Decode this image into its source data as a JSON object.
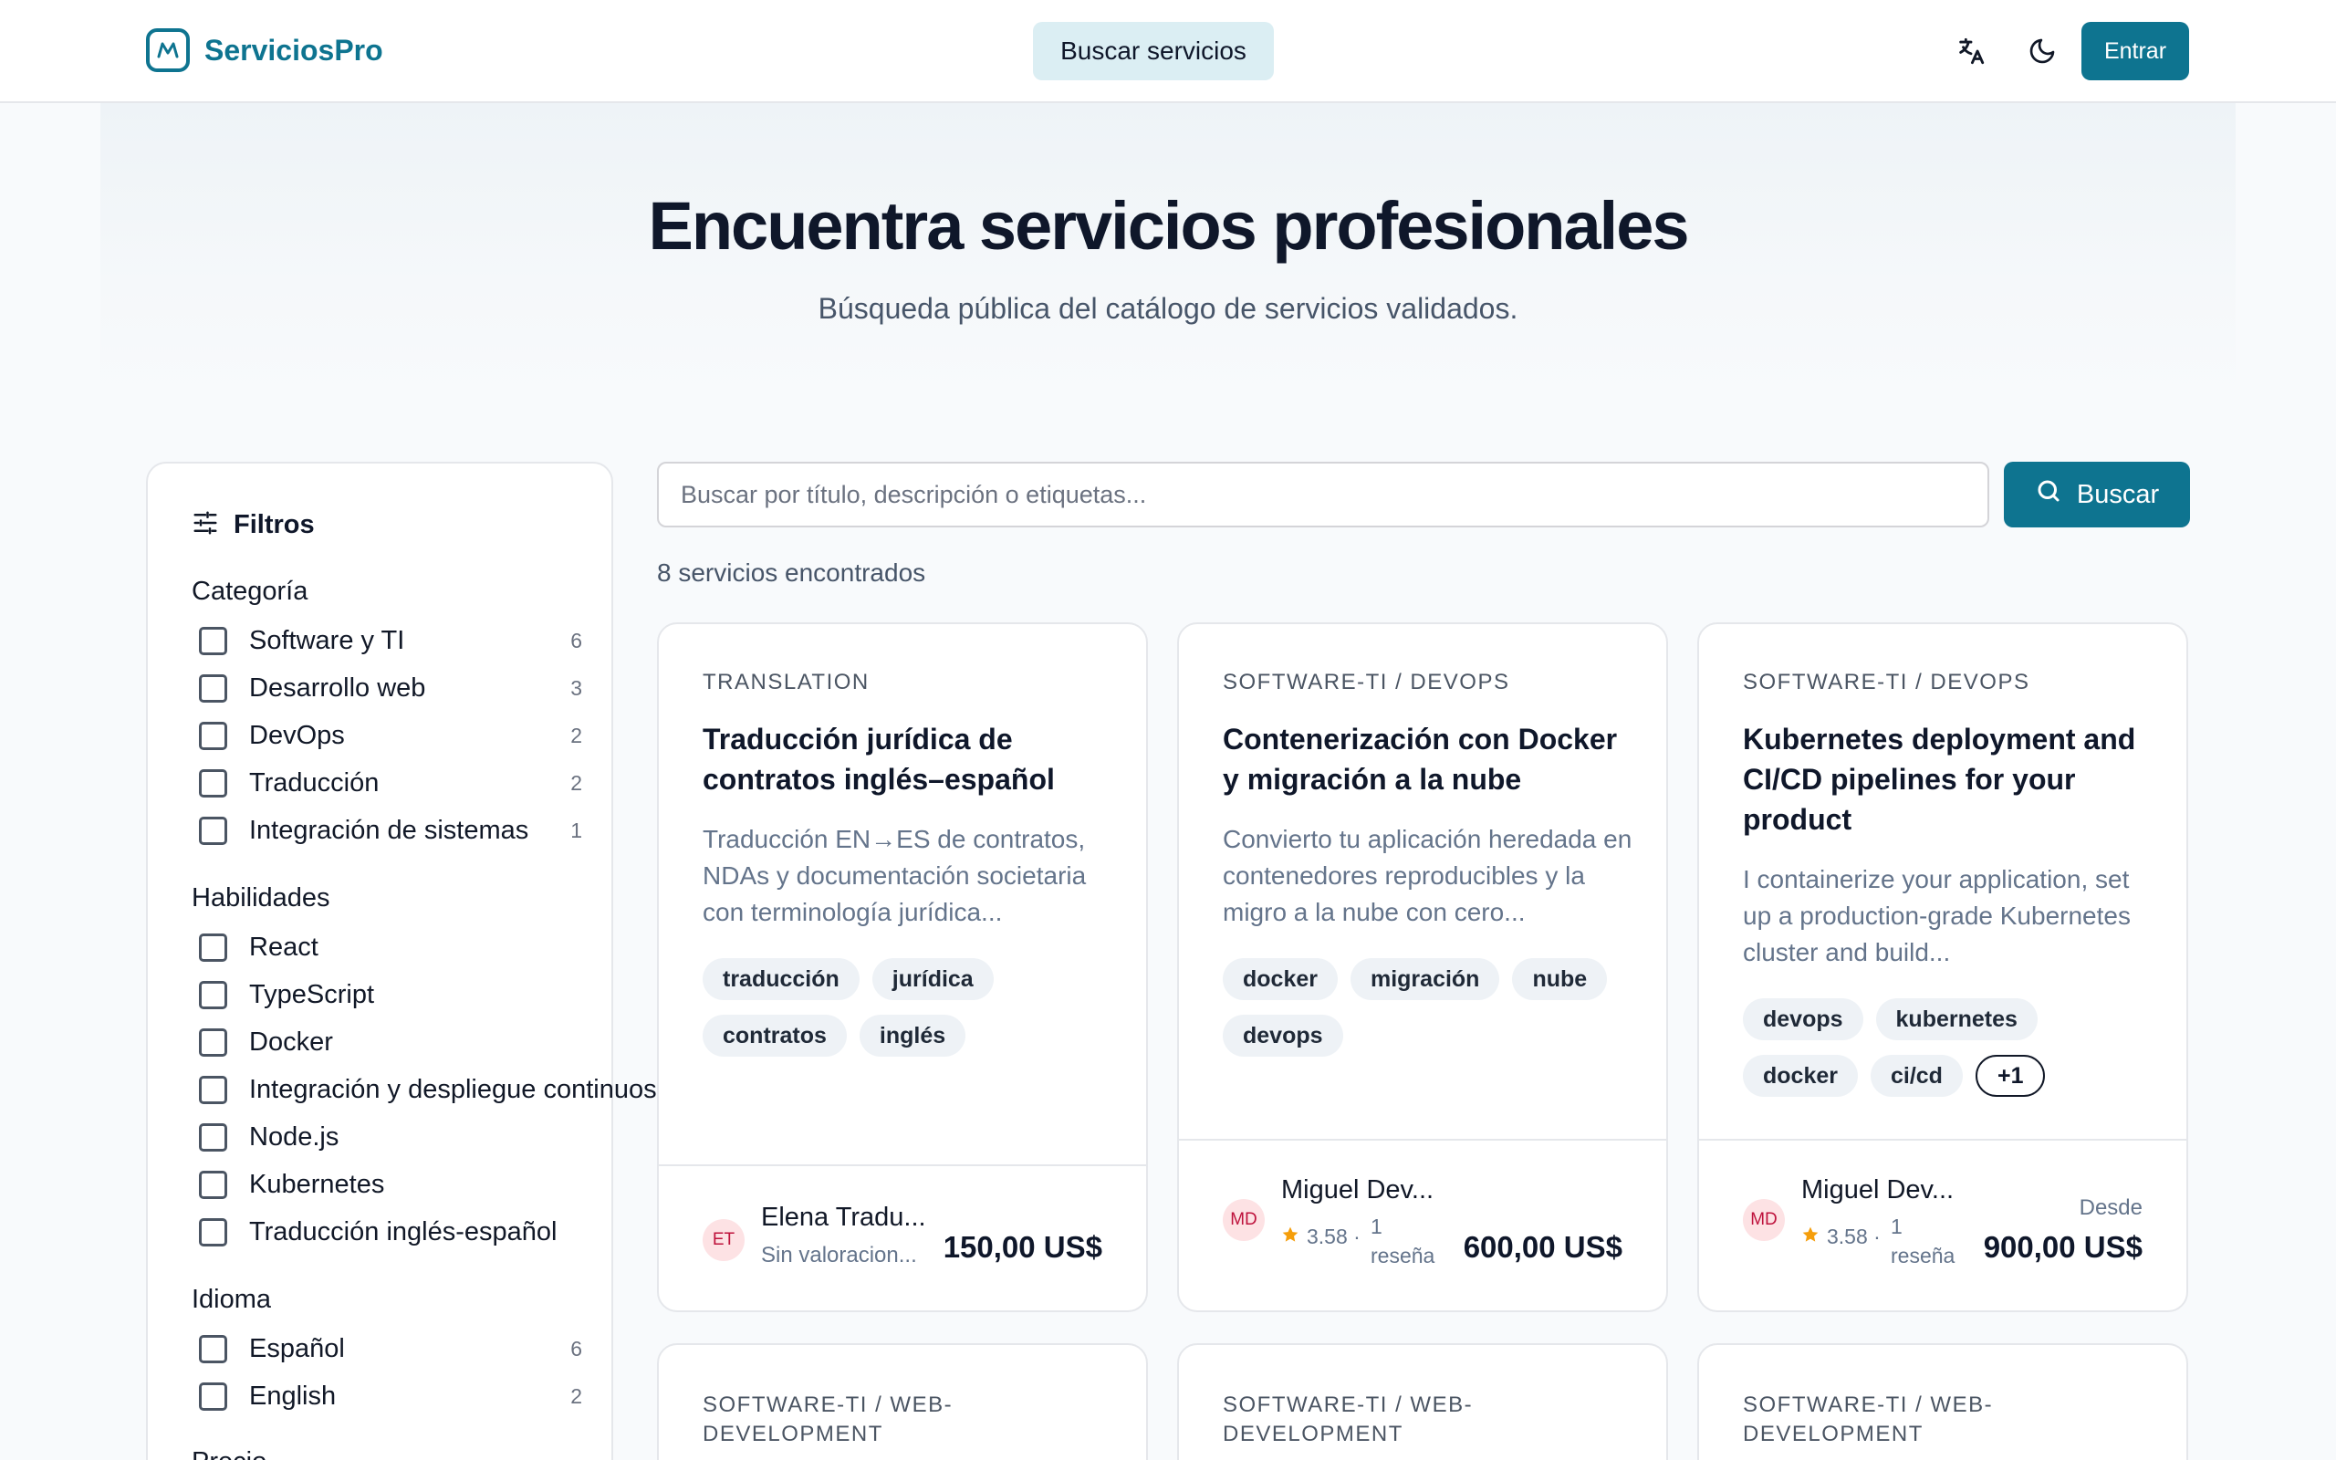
{
  "header": {
    "brand": "ServiciosPro",
    "nav_search": "Buscar servicios",
    "login": "Entrar"
  },
  "hero": {
    "title": "Encuentra servicios profesionales",
    "subtitle": "Búsqueda pública del catálogo de servicios validados."
  },
  "filters": {
    "title": "Filtros",
    "category": {
      "title": "Categoría",
      "options": [
        {
          "label": "Software y TI",
          "count": "6"
        },
        {
          "label": "Desarrollo web",
          "count": "3"
        },
        {
          "label": "DevOps",
          "count": "2"
        },
        {
          "label": "Traducción",
          "count": "2"
        },
        {
          "label": "Integración de sistemas",
          "count": "1"
        }
      ]
    },
    "skills": {
      "title": "Habilidades",
      "options": [
        {
          "label": "React"
        },
        {
          "label": "TypeScript"
        },
        {
          "label": "Docker"
        },
        {
          "label": "Integración y despliegue continuos"
        },
        {
          "label": "Node.js"
        },
        {
          "label": "Kubernetes"
        },
        {
          "label": "Traducción inglés-español"
        }
      ]
    },
    "language": {
      "title": "Idioma",
      "options": [
        {
          "label": "Español",
          "count": "6"
        },
        {
          "label": "English",
          "count": "2"
        }
      ]
    },
    "price_title": "Precio"
  },
  "search": {
    "placeholder": "Buscar por título, descripción o etiquetas...",
    "button": "Buscar",
    "results": "8 servicios encontrados"
  },
  "cards": [
    {
      "category": "TRANSLATION",
      "title": "Traducción jurídica de contratos inglés–español",
      "description": "Traducción EN→ES de contratos, NDAs y documentación societaria con terminología jurídica...",
      "tags": [
        "traducción",
        "jurídica",
        "contratos",
        "inglés"
      ],
      "avatar": "ET",
      "provider": "Elena Tradu...",
      "rating_text": "Sin valoracion...",
      "price": "150,00 US$"
    },
    {
      "category": "SOFTWARE-TI / DEVOPS",
      "title": "Contenerización con Docker y migración a la nube",
      "description": "Convierto tu aplicación heredada en contenedores reproducibles y la migro a la nube con cero...",
      "tags": [
        "docker",
        "migración",
        "nube",
        "devops"
      ],
      "avatar": "MD",
      "provider": "Miguel Dev...",
      "rating": "3.58 ·",
      "reviews": "1 reseña",
      "price": "600,00 US$"
    },
    {
      "category": "SOFTWARE-TI / DEVOPS",
      "title": "Kubernetes deployment and CI/CD pipelines for your product",
      "description": "I containerize your application, set up a production-grade Kubernetes cluster and build...",
      "tags": [
        "devops",
        "kubernetes",
        "docker",
        "ci/cd"
      ],
      "more": "+1",
      "avatar": "MD",
      "provider": "Miguel Dev...",
      "rating": "3.58 ·",
      "reviews": "1 reseña",
      "price_prefix": "Desde",
      "price": "900,00 US$"
    }
  ],
  "more_cards": [
    {
      "category": "SOFTWARE-TI / WEB-DEVELOPMENT"
    },
    {
      "category": "SOFTWARE-TI / WEB-DEVELOPMENT"
    },
    {
      "category": "SOFTWARE-TI / WEB-DEVELOPMENT"
    }
  ]
}
